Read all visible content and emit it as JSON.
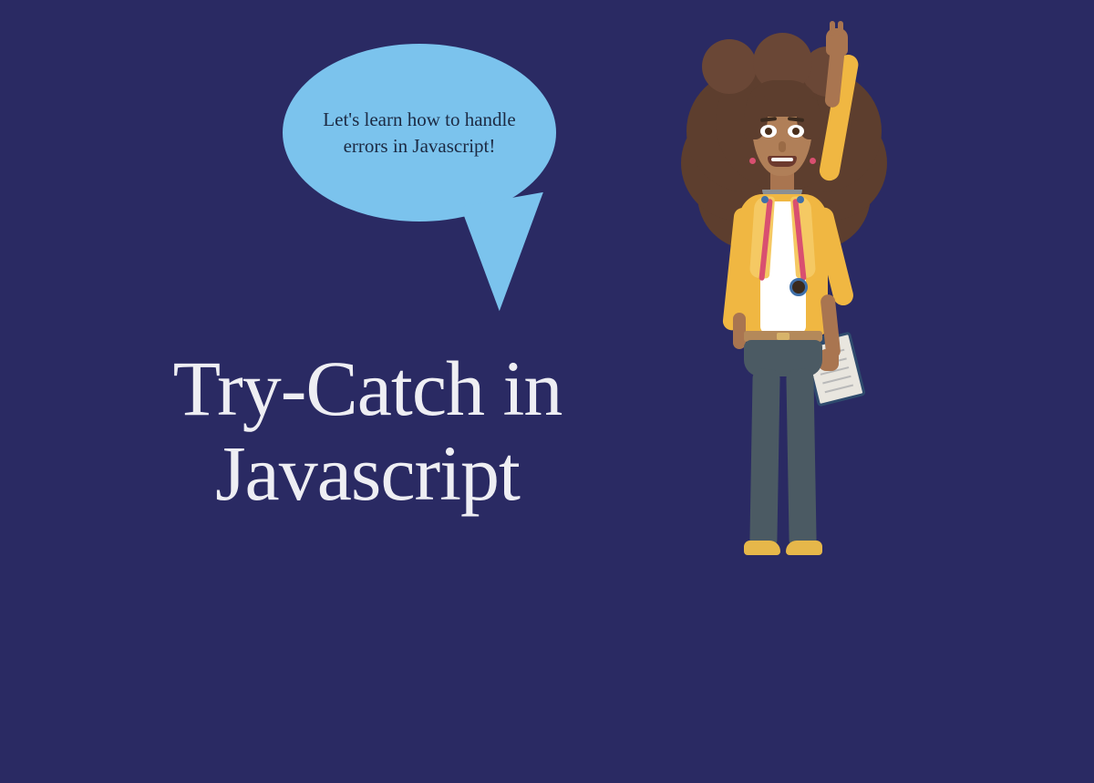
{
  "speech_bubble": {
    "text": "Let's learn how to handle errors in Javascript!"
  },
  "title": {
    "text": "Try-Catch in Javascript"
  }
}
